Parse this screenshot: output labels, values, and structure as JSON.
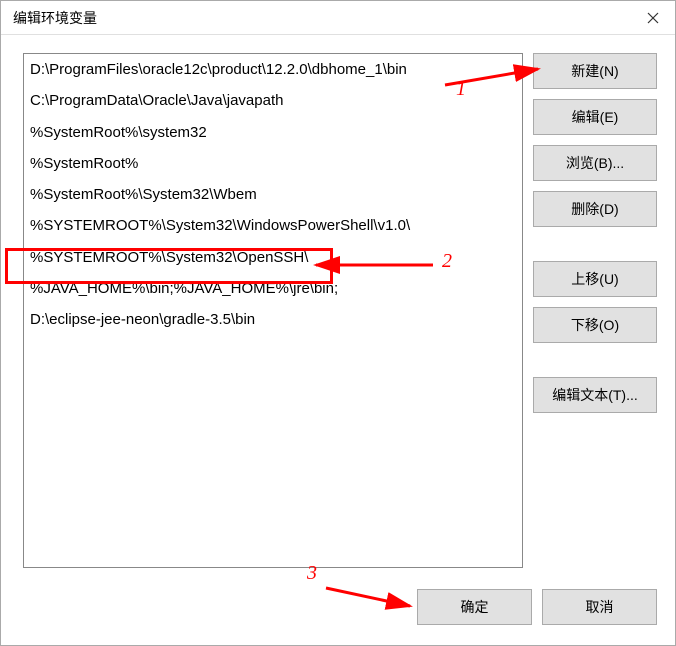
{
  "window": {
    "title": "编辑环境变量"
  },
  "list": {
    "items": [
      "D:\\ProgramFiles\\oracle12c\\product\\12.2.0\\dbhome_1\\bin",
      "C:\\ProgramData\\Oracle\\Java\\javapath",
      "%SystemRoot%\\system32",
      "%SystemRoot%",
      "%SystemRoot%\\System32\\Wbem",
      "%SYSTEMROOT%\\System32\\WindowsPowerShell\\v1.0\\",
      "%SYSTEMROOT%\\System32\\OpenSSH\\",
      "%JAVA_HOME%\\bin;%JAVA_HOME%\\jre\\bin;",
      "D:\\eclipse-jee-neon\\gradle-3.5\\bin"
    ]
  },
  "buttons": {
    "new": "新建(N)",
    "edit": "编辑(E)",
    "browse": "浏览(B)...",
    "delete": "删除(D)",
    "moveup": "上移(U)",
    "movedown": "下移(O)",
    "edittext": "编辑文本(T)...",
    "ok": "确定",
    "cancel": "取消"
  },
  "annotations": {
    "label1": "1",
    "label2": "2",
    "label3": "3"
  }
}
